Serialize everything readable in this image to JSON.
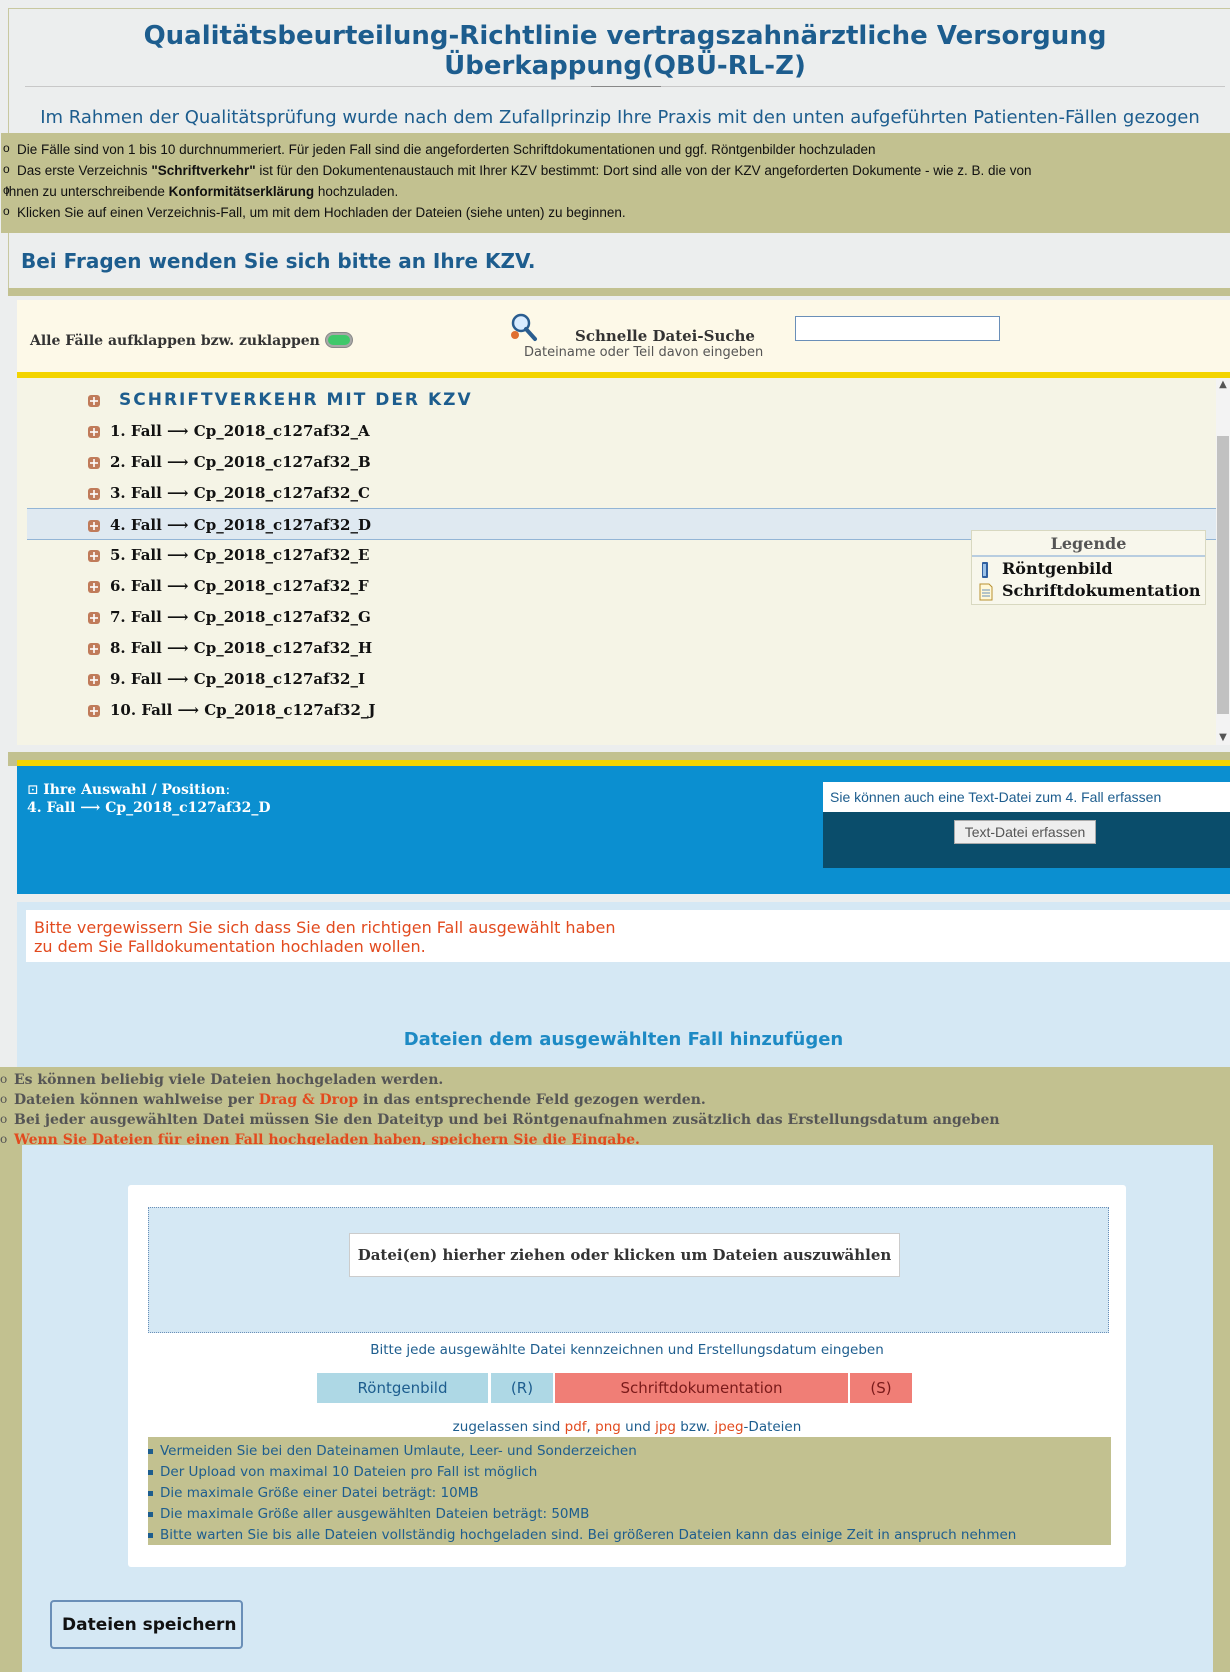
{
  "header": {
    "title": "Qualitätsbeurteilung-Richtlinie vertragszahnärztliche Versorgung Überkappung(QBÜ-RL-Z)",
    "subtitle": "Im Rahmen der Qualitätsprüfung wurde nach dem Zufallprinzip Ihre Praxis mit den unten aufgeführten Patienten-Fällen gezogen",
    "info": {
      "line1": "Die Fälle sind von 1 bis 10 durchnummeriert. Für jeden Fall sind die angeforderten Schriftdokumentationen und ggf. Röntgenbilder hochzuladen",
      "line2_pre": "Das erste Verzeichnis ",
      "line2_bold": "\"Schriftverkehr\"",
      "line2_post": " ist für den Dokumentenaustauch mit Ihrer KZV bestimmt: Dort sind alle von der KZV angeforderten Dokumente - wie z. B. die von",
      "line3_pre": "Ihnen zu unterschreibende ",
      "line3_bold": "Konformitätserklärung",
      "line3_post": " hochzuladen.",
      "line4": "Klicken Sie auf einen Verzeichnis-Fall, um mit dem Hochladen der Dateien (siehe unten) zu beginnen."
    },
    "kzv_line": "Bei Fragen wenden Sie sich bitte an Ihre KZV."
  },
  "toolbar": {
    "toggle_label": "Alle Fälle aufklappen bzw. zuklappen",
    "search_label": "Schnelle Datei-Suche",
    "search_hint": "Dateiname oder Teil davon eingeben",
    "search_value": ""
  },
  "tree": {
    "root": "SCHRIFTVERKEHR MIT DER KZV",
    "cases": [
      "1. Fall ⟶ Cp_2018_c127af32_A",
      "2. Fall ⟶ Cp_2018_c127af32_B",
      "3. Fall ⟶ Cp_2018_c127af32_C",
      "4. Fall ⟶ Cp_2018_c127af32_D",
      "5. Fall ⟶ Cp_2018_c127af32_E",
      "6. Fall ⟶ Cp_2018_c127af32_F",
      "7. Fall ⟶ Cp_2018_c127af32_G",
      "8. Fall ⟶ Cp_2018_c127af32_H",
      "9. Fall ⟶ Cp_2018_c127af32_I",
      "10. Fall ⟶ Cp_2018_c127af32_J"
    ],
    "selected_index": 3
  },
  "legend": {
    "title": "Legende",
    "xray": "Röntgenbild",
    "doc": "Schriftdokumentation"
  },
  "selection": {
    "label": "Ihre Auswahl / Position",
    "value": "4. Fall ⟶ Cp_2018_c127af32_D",
    "textfile_hint": "Sie können auch eine Text-Datei zum 4. Fall erfassen",
    "textfile_button": "Text-Datei erfassen"
  },
  "upload": {
    "warning_line1": "Bitte vergewissern Sie sich dass Sie den richtigen Fall ausgewählt haben",
    "warning_line2": "zu dem Sie Falldokumentation hochladen wollen.",
    "heading": "Dateien dem ausgewählten Fall hinzufügen",
    "info1": "Es können beliebig viele Dateien hochgeladen werden.",
    "info2_pre": "Dateien können wahlweise per ",
    "info2_red": "Drag & Drop",
    "info2_post": " in das entsprechende Feld gezogen werden.",
    "info3": "Bei jeder ausgewählten Datei müssen Sie den Dateityp und bei Röntgenaufnahmen zusätzlich das Erstellungsdatum angeben",
    "info4": "Wenn Sie Dateien für einen Fall hochgeladen haben, speichern Sie die Eingabe.",
    "dropzone": "Datei(en) hierher ziehen oder klicken um Dateien auszuwählen",
    "mark_hint": "Bitte jede ausgewählte Datei kennzeichnen und Erstellungsdatum eingeben",
    "type_xray": "Röntgenbild",
    "type_xray_key": "(R)",
    "type_doc": "Schriftdokumentation",
    "type_doc_key": "(S)",
    "allowed_pre": "zugelassen sind ",
    "allowed_pdf": "pdf",
    "allowed_sep1": ", ",
    "allowed_png": "png",
    "allowed_und": " und ",
    "allowed_jpg": "jpg",
    "allowed_bzw": " bzw. ",
    "allowed_jpeg": "jpeg",
    "allowed_post": "-Dateien",
    "rules": [
      "Vermeiden Sie bei den Dateinamen Umlaute, Leer- und Sonderzeichen",
      "Der Upload von maximal 10 Dateien pro Fall ist möglich",
      "Die maximale Größe einer Datei beträgt: 10MB",
      "Die maximale Größe aller ausgewählten Dateien beträgt: 50MB",
      "Bitte warten Sie bis alle Dateien vollständig hochgeladen sind. Bei größeren Dateien kann das einige Zeit in anspruch nehmen"
    ],
    "save_button": "Dateien speichern"
  },
  "colors": {
    "accent_blue": "#1d5d8e",
    "olive": "#c2c190",
    "yellow": "#f3d400",
    "selection_blue": "#0b8fd0",
    "warning_red": "#e24a1e"
  },
  "icons": {
    "tree_node": "folder-expand-icon",
    "search": "magnifier-icon",
    "xray": "xray-icon",
    "doc": "document-icon"
  }
}
